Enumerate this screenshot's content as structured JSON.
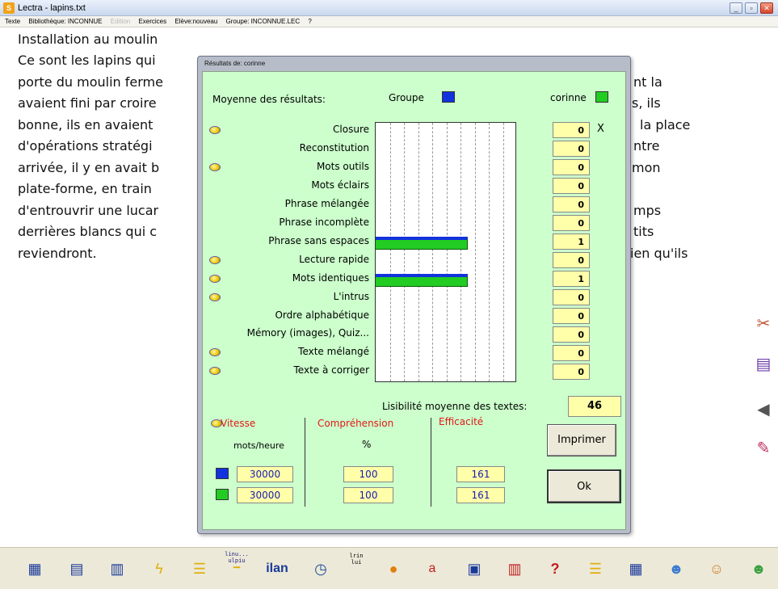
{
  "window": {
    "title": "Lectra - lapins.txt",
    "icon": "lectra-app-icon",
    "buttons": [
      "minimize-icon",
      "maximize-icon",
      "close-icon"
    ]
  },
  "menu": {
    "texte": "Texte",
    "bibliotheque": "Bibliothèque: INCONNUE",
    "edition": "Edition",
    "exercices": "Exercices",
    "eleve": "Elève:nouveau",
    "groupe": "Groupe: INCONNUE.LEC",
    "help": "?"
  },
  "document": {
    "lines_left": [
      "Installation au moulin",
      "Ce sont les lapins qui",
      "porte du moulin ferme",
      "avaient fini par croire",
      "bonne, ils en avaient",
      "d'opérations stratégi",
      "arrivée, il y en avait b",
      "plate-forme, en train",
      "d'entrouvrir une lucar",
      "derrières blancs qui c",
      "reviendront."
    ],
    "lines_right": [
      "nt la",
      "s, ils",
      "la place",
      "ntre",
      "mon",
      "mps",
      "tits",
      "ien qu'ils"
    ]
  },
  "dialog": {
    "title": "Résultats de: corinne",
    "header_label": "Moyenne des résultats:",
    "group_label": "Groupe",
    "student_label": "corinne",
    "colors": {
      "group": "#1133dd",
      "student": "#22cc22",
      "background": "#ccffcc",
      "field": "#ffffaa",
      "red": "#e01818"
    },
    "exercises": [
      {
        "name": "Closure",
        "score": "0",
        "dot": true,
        "x_mark": "X"
      },
      {
        "name": "Reconstitution",
        "score": "0",
        "dot": false
      },
      {
        "name": "Mots outils",
        "score": "0",
        "dot": true
      },
      {
        "name": "Mots éclairs",
        "score": "0",
        "dot": false
      },
      {
        "name": "Phrase mélangée",
        "score": "0",
        "dot": false
      },
      {
        "name": "Phrase incomplète",
        "score": "0",
        "dot": false
      },
      {
        "name": "Phrase sans espaces",
        "score": "1",
        "dot": false,
        "bar_fraction": 0.65
      },
      {
        "name": "Lecture rapide",
        "score": "0",
        "dot": true
      },
      {
        "name": "Mots identiques",
        "score": "1",
        "dot": true,
        "bar_fraction": 0.65
      },
      {
        "name": "L'intrus",
        "score": "0",
        "dot": true
      },
      {
        "name": "Ordre alphabétique",
        "score": "0",
        "dot": false
      },
      {
        "name": "Mémory (images), Quiz...",
        "score": "0",
        "dot": false
      },
      {
        "name": "Texte mélangé",
        "score": "0",
        "dot": true
      },
      {
        "name": "Texte à corriger",
        "score": "0",
        "dot": true
      }
    ],
    "lisibilite_label": "Lisibilité moyenne des textes:",
    "lisibilite_value": "46",
    "vitesse_label": "Vitesse",
    "vitesse_unit": "mots/heure",
    "comprehension_label": "Compréhension",
    "comprehension_unit": "%",
    "efficacite_label": "Efficacité",
    "group_row": {
      "vitesse": "30000",
      "comprehension": "100",
      "efficacite": "161"
    },
    "student_row": {
      "vitesse": "30000",
      "comprehension": "100",
      "efficacite": "161"
    },
    "print_button": "Imprimer",
    "ok_button": "Ok"
  },
  "side_icons": [
    "tools-icon",
    "books-icon",
    "speaker-icon",
    "edit-icon"
  ],
  "toolbar": {
    "icons": [
      "closure-icon",
      "reconstitution-icon",
      "mots-outils-icon",
      "eclair-icon",
      "phrase-melangee-icon",
      "phrase-incomplete-icon",
      "phrase-sans-espaces-icon",
      "lecture-rapide-icon",
      "mots-identiques-icon",
      "intrus-icon",
      "ordre-alpha-icon",
      "memory-icon",
      "quiz-icon",
      "texte-melange-icon",
      "texte-corriger-icon",
      "user-group-icon",
      "user-icon",
      "users-icon"
    ],
    "mini_texts": {
      "lin": "linu...",
      "ulp": "ulpiu",
      "ilan": "ilan",
      "lrin": "lrin",
      "lui": "lui",
      "q": "?",
      "ab": "a"
    }
  }
}
